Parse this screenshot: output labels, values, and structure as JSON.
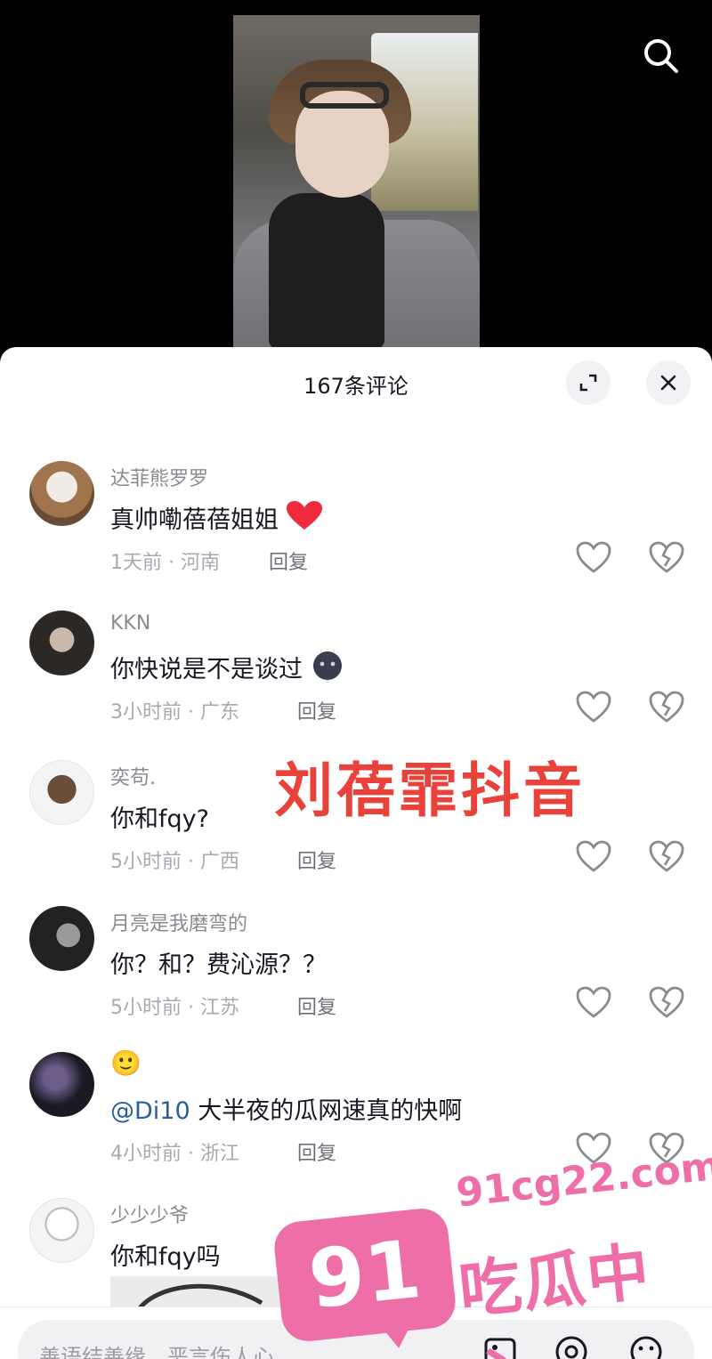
{
  "header": {
    "comment_count_title": "167条评论"
  },
  "icons": {
    "search": "search-icon",
    "expand": "expand-icon",
    "close": "close-icon",
    "like": "heart-icon",
    "dislike": "broken-heart-icon",
    "image": "image-icon",
    "mention": "at-icon",
    "emoji": "emoji-icon"
  },
  "comments": [
    {
      "user": "达菲熊罗罗",
      "text": "真帅嘞蓓蓓姐姐",
      "emoji": "❤️",
      "time_location": "1天前 · 河南",
      "reply": "回复"
    },
    {
      "user": "KKN",
      "text": "你快说是不是谈过",
      "emoji": "dark-face",
      "time_location": "3小时前 · 广东",
      "reply": "回复"
    },
    {
      "user": "奕苟.",
      "text": "你和fqy?",
      "time_location": "5小时前 · 广西",
      "reply": "回复"
    },
    {
      "user": "月亮是我磨弯的",
      "text": "你？和？费沁源？？",
      "time_location": "5小时前 · 江苏",
      "reply": "回复"
    },
    {
      "user": "🙂",
      "mention": "@Di10",
      "text": " 大半夜的瓜网速真的快啊",
      "time_location": "4小时前 · 浙江",
      "reply": "回复"
    },
    {
      "user": "少少少爷",
      "text": "你和fqy吗"
    }
  ],
  "overlay_caption": "刘蓓霏抖音",
  "input": {
    "placeholder": "善语结善缘，恶言伤人心"
  },
  "watermark": {
    "badge": "91",
    "domain": "91cg22.com",
    "name": "吃瓜中心"
  },
  "colors": {
    "overlay_red": "#e8423a",
    "watermark_pink": "#ee6ea8",
    "mention_blue": "#2b5c9c"
  }
}
